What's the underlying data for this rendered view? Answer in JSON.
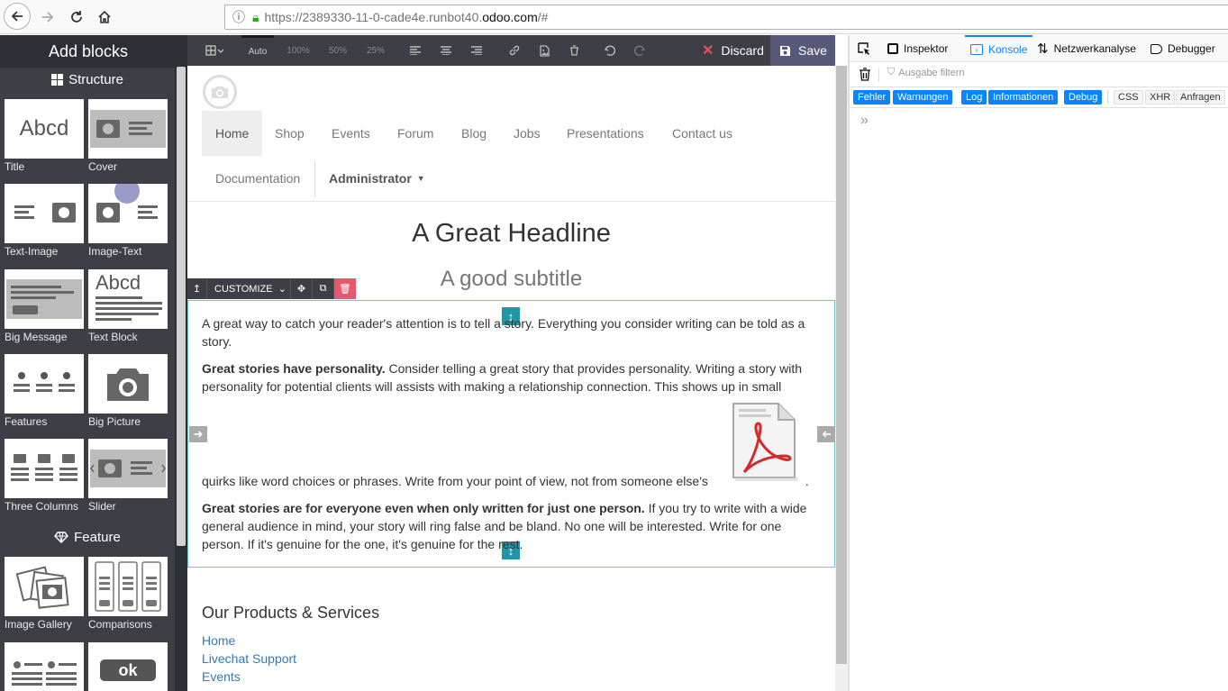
{
  "browser": {
    "url_prefix": "https://2389330-11-0-cade4e.runbot40.",
    "url_domain": "odoo.com",
    "url_suffix": "/#"
  },
  "sidebar": {
    "title": "Add blocks",
    "categories": [
      {
        "label": "Structure"
      },
      {
        "label": "Feature"
      }
    ],
    "blocks": [
      {
        "label": "Title"
      },
      {
        "label": "Cover"
      },
      {
        "label": "Text-Image"
      },
      {
        "label": "Image-Text"
      },
      {
        "label": "Big Message"
      },
      {
        "label": "Text Block"
      },
      {
        "label": "Features"
      },
      {
        "label": "Big Picture"
      },
      {
        "label": "Three Columns"
      },
      {
        "label": "Slider"
      },
      {
        "label": "Image Gallery"
      },
      {
        "label": "Comparisons"
      }
    ],
    "thumb_text": {
      "abcd": "Abcd",
      "ok": "ok"
    }
  },
  "editor_toolbar": {
    "auto": "Auto",
    "w100": "100%",
    "w50": "50%",
    "w25": "25%",
    "discard": "Discard",
    "save": "Save"
  },
  "menu": {
    "items": [
      "Home",
      "Shop",
      "Events",
      "Forum",
      "Blog",
      "Jobs",
      "Presentations",
      "Contact us",
      "Documentation"
    ],
    "admin": "Administrator"
  },
  "content": {
    "headline": "A Great Headline",
    "subtitle": "A good subtitle",
    "customize": "CUSTOMIZE",
    "p1": "A great way to catch your reader's attention is to tell a story. Everything you consider writing can be told as a story.",
    "p2_bold": "Great stories have personality.",
    "p2_a": " Consider telling a great story that provides personality. Writing a story with personality for potential clients will assists with making a relationship connection. This shows up in small",
    "p2_b": "quirks like word choices or phrases. Write from your point of view, not from someone else's",
    "p2_end": ".",
    "p3_bold": "Great stories are for everyone even when only written for just one person.",
    "p3": " If you try to write with a wide general audience in mind, your story will ring false and be bland. No one will be interested. Write for one person. If it's genuine for the one, it's genuine for the rest.",
    "products_heading": "Our Products & Services",
    "product_links": [
      "Home",
      "Livechat Support",
      "Events"
    ]
  },
  "devtools": {
    "tabs": [
      "Inspektor",
      "Konsole",
      "Netzwerkanalyse",
      "Debugger"
    ],
    "filter_placeholder": "Ausgabe filtern",
    "levels": [
      "Fehler",
      "Warnungen",
      "Log",
      "Informationen",
      "Debug"
    ],
    "requests": [
      "CSS",
      "XHR",
      "Anfragen"
    ],
    "prompt": "»"
  },
  "colors": {
    "sidebar_bg": "#3e3e46",
    "save_bg": "#58587a",
    "accent": "#0a84ff",
    "link": "#337ab7",
    "handle": "#1f97a6"
  }
}
